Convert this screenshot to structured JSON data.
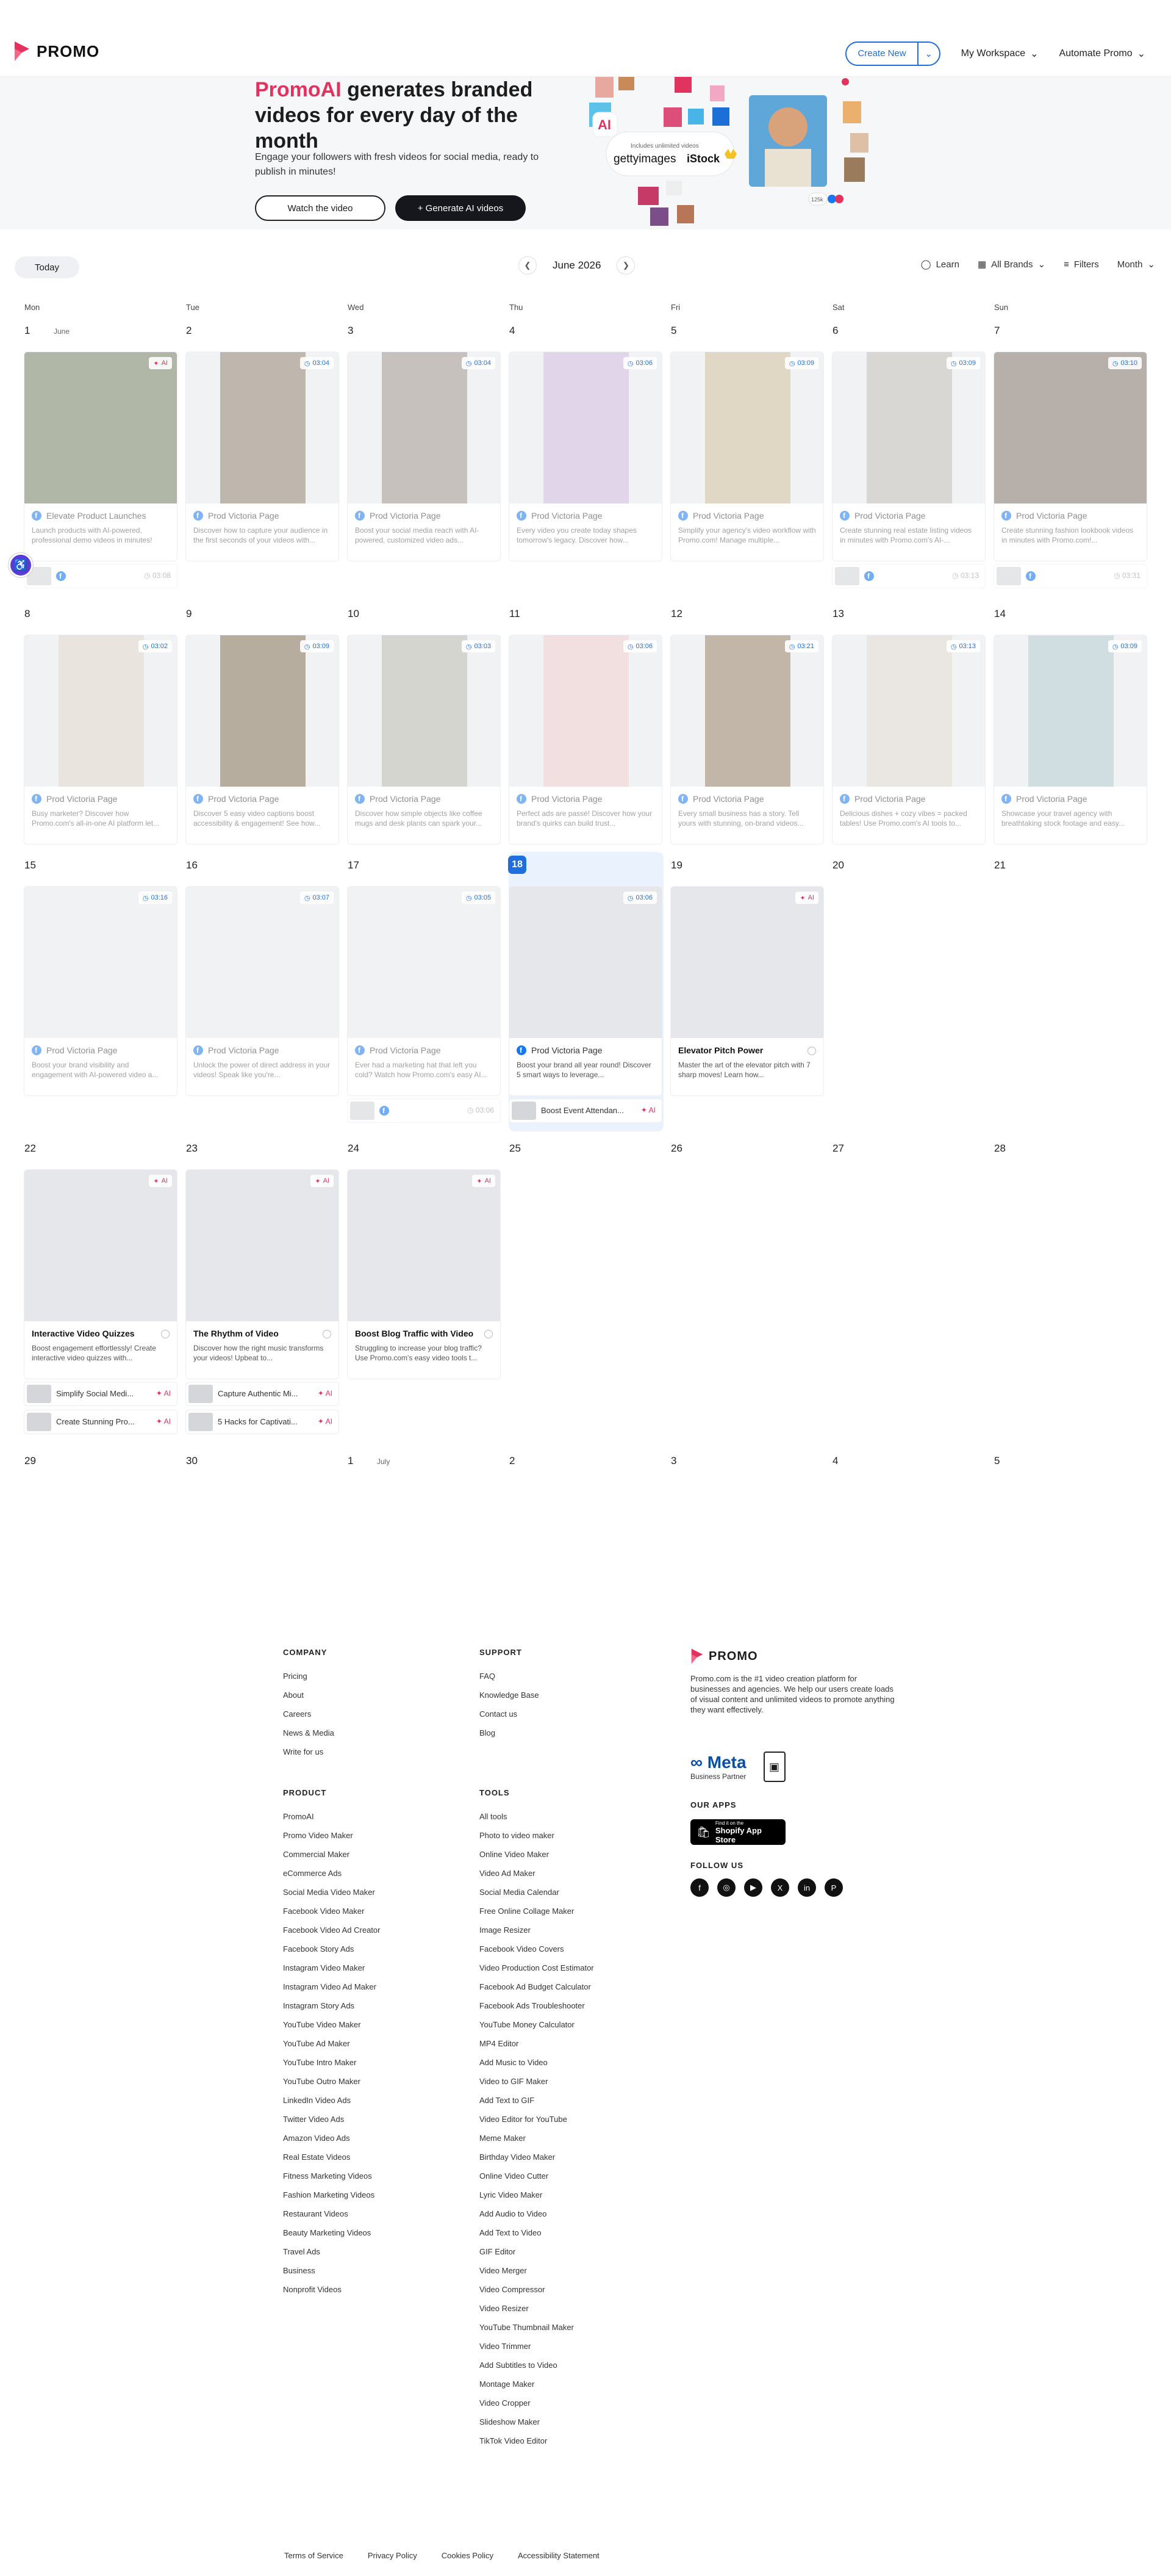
{
  "header": {
    "logo": "PROMO",
    "create_new": "Create New",
    "my_workspace": "My Workspace",
    "automate_promo": "Automate Promo"
  },
  "hero": {
    "title_brand": "PromoAI",
    "title_rest": " generates branded videos for every day of the month",
    "subtitle": "Engage your followers with fresh videos for social media, ready to publish in minutes!",
    "btn_watch": "Watch the video",
    "btn_generate": "+ Generate AI videos",
    "collage_text1": "Includes unlimited videos",
    "collage_getty": "gettyimages",
    "collage_istock": "iStock",
    "collage_ai": "AI",
    "collage_count": "125k"
  },
  "toolbar": {
    "today": "Today",
    "month_title": "June 2026",
    "learn": "Learn",
    "all_brands": "All Brands",
    "filters": "Filters",
    "view": "Month"
  },
  "weekdays": [
    "Mon",
    "Tue",
    "Wed",
    "Thu",
    "Fri",
    "Sat",
    "Sun"
  ],
  "labels": {
    "june": "June",
    "july": "July",
    "ai": "AI",
    "page": "Prod Victoria Page"
  },
  "weeks": [
    [
      "1",
      "2",
      "3",
      "4",
      "5",
      "6",
      "7"
    ],
    [
      "8",
      "9",
      "10",
      "11",
      "12",
      "13",
      "14"
    ],
    [
      "15",
      "16",
      "17",
      "18",
      "19",
      "20",
      "21"
    ],
    [
      "22",
      "23",
      "24",
      "25",
      "26",
      "27",
      "28"
    ],
    [
      "29",
      "30",
      "1",
      "2",
      "3",
      "4",
      "5"
    ]
  ],
  "cards": [
    {
      "title": "Elevate Product Launches",
      "desc": "Launch products with AI-powered, professional demo videos in minutes!",
      "tag": "AI",
      "faded": true,
      "sub": {
        "type": "fb",
        "time": "03:08"
      }
    },
    {
      "title": "Prod Victoria Page",
      "desc": "Discover how to capture your audience in the first seconds of your videos with...",
      "tag": "03:04",
      "faded": true
    },
    {
      "title": "Prod Victoria Page",
      "desc": "Boost your social media reach with AI-powered, customized video ads...",
      "tag": "03:04",
      "faded": true
    },
    {
      "title": "Prod Victoria Page",
      "desc": "Every video you create today shapes tomorrow's legacy. Discover how...",
      "tag": "03:06",
      "faded": true
    },
    {
      "title": "Prod Victoria Page",
      "desc": "Simplify your agency's video workflow with Promo.com! Manage multiple...",
      "tag": "03:09",
      "faded": true
    },
    {
      "title": "Prod Victoria Page",
      "desc": "Create stunning real estate listing videos in minutes with Promo.com's AI-...",
      "tag": "03:09",
      "faded": true,
      "sub": {
        "type": "fb",
        "time": "03:13"
      }
    },
    {
      "title": "Prod Victoria Page",
      "desc": "Create stunning fashion lookbook videos in minutes with Promo.com!...",
      "tag": "03:10",
      "faded": true,
      "sub": {
        "type": "fb",
        "time": "03:31"
      }
    },
    {
      "title": "Prod Victoria Page",
      "desc": "Busy marketer? Discover how Promo.com's all-in-one AI platform let...",
      "tag": "03:02",
      "faded": true
    },
    {
      "title": "Prod Victoria Page",
      "desc": "Discover 5 easy video captions boost accessibility & engagement! See how...",
      "tag": "03:09",
      "faded": true
    },
    {
      "title": "Prod Victoria Page",
      "desc": "Discover how simple objects like coffee mugs and desk plants can spark your...",
      "tag": "03:03",
      "faded": true
    },
    {
      "title": "Prod Victoria Page",
      "desc": "Perfect ads are passé! Discover how your brand's quirks can build trust...",
      "tag": "03:06",
      "faded": true
    },
    {
      "title": "Prod Victoria Page",
      "desc": "Every small business has a story. Tell yours with stunning, on-brand videos...",
      "tag": "03:21",
      "faded": true
    },
    {
      "title": "Prod Victoria Page",
      "desc": "Delicious dishes + cozy vibes = packed tables! Use Promo.com's AI tools to...",
      "tag": "03:13",
      "faded": true
    },
    {
      "title": "Prod Victoria Page",
      "desc": "Showcase your travel agency with breathtaking stock footage and easy...",
      "tag": "03:09",
      "faded": true
    },
    {
      "title": "Prod Victoria Page",
      "desc": "Boost your brand visibility and engagement with AI-powered video a...",
      "tag": "03:16",
      "faded": true
    },
    {
      "title": "Prod Victoria Page",
      "desc": "Unlock the power of direct address in your videos! Speak like you're...",
      "tag": "03:07",
      "faded": true
    },
    {
      "title": "Prod Victoria Page",
      "desc": "Ever had a marketing hat that left you cold? Watch how Promo.com's easy AI...",
      "tag": "03:05",
      "faded": true,
      "sub": {
        "type": "fb",
        "time": "03:06"
      }
    },
    {
      "title": "Prod Victoria Page",
      "desc": "Boost your brand all year round! Discover 5 smart ways to leverage...",
      "tag": "03:06",
      "faded": false,
      "timetag": true,
      "sub": {
        "type": "text",
        "text": "Boost Event Attendan...",
        "ai": "AI"
      }
    },
    {
      "title": "Elevator Pitch Power",
      "desc": "Master the art of the elevator pitch with 7 sharp moves! Learn how...",
      "tag": "AI",
      "faded": false,
      "bold": true
    },
    {
      "title": "Interactive Video Quizzes",
      "desc": "Boost engagement effortlessly! Create interactive video quizzes with...",
      "tag": "AI",
      "faded": false,
      "bold": true,
      "subs": [
        {
          "text": "Simplify Social Medi...",
          "ai": "AI"
        },
        {
          "text": "Create Stunning Pro...",
          "ai": "AI"
        }
      ]
    },
    {
      "title": "The Rhythm of Video",
      "desc": "Discover how the right music transforms your videos! Upbeat to...",
      "tag": "AI",
      "faded": false,
      "bold": true,
      "subs": [
        {
          "text": "Capture Authentic Mi...",
          "ai": "AI"
        },
        {
          "text": "5 Hacks for Captivati...",
          "ai": "AI"
        }
      ]
    },
    {
      "title": "Boost Blog Traffic with Video",
      "desc": "Struggling to increase your blog traffic? Use Promo.com's easy video tools t...",
      "tag": "AI",
      "faded": false,
      "bold": true
    }
  ],
  "footer": {
    "company_title": "COMPANY",
    "company": [
      "Pricing",
      "About",
      "Careers",
      "News & Media",
      "Write for us"
    ],
    "support_title": "SUPPORT",
    "support": [
      "FAQ",
      "Knowledge Base",
      "Contact us",
      "Blog"
    ],
    "product_title": "PRODUCT",
    "product": [
      "PromoAI",
      "Promo Video Maker",
      "Commercial Maker",
      "eCommerce Ads",
      "Social Media Video Maker",
      "Facebook Video Maker",
      "Facebook Video Ad Creator",
      "Facebook Story Ads",
      "Instagram Video Maker",
      "Instagram Video Ad Maker",
      "Instagram Story Ads",
      "YouTube Video Maker",
      "YouTube Ad Maker",
      "YouTube Intro Maker",
      "YouTube Outro Maker",
      "LinkedIn Video Ads",
      "Twitter Video Ads",
      "Amazon Video Ads",
      "Real Estate Videos",
      "Fitness Marketing Videos",
      "Fashion Marketing Videos",
      "Restaurant Videos",
      "Beauty Marketing Videos",
      "Travel Ads",
      "Business",
      "Nonprofit Videos"
    ],
    "tools_title": "TOOLS",
    "tools": [
      "All tools",
      "Photo to video maker",
      "Online Video Maker",
      "Video Ad Maker",
      "Social Media Calendar",
      "Free Online Collage Maker",
      "Image Resizer",
      "Facebook Video Covers",
      "Video Production Cost Estimator",
      "Facebook Ad Budget Calculator",
      "Facebook Ads Troubleshooter",
      "YouTube Money Calculator",
      "MP4 Editor",
      "Add Music to Video",
      "Video to GIF Maker",
      "Add Text to GIF",
      "Video Editor for YouTube",
      "Meme Maker",
      "Birthday Video Maker",
      "Online Video Cutter",
      "Lyric Video Maker",
      "Add Audio to Video",
      "Add Text to Video",
      "GIF Editor",
      "Video Merger",
      "Video Compressor",
      "Video Resizer",
      "YouTube Thumbnail Maker",
      "Video Trimmer",
      "Add Subtitles to Video",
      "Montage Maker",
      "Video Cropper",
      "Slideshow Maker",
      "TikTok Video Editor"
    ],
    "about_logo": "PROMO",
    "about": "Promo.com is the #1 video creation platform for businesses and agencies. We help our users create loads of visual content and unlimited videos to promote anything they want effectively.",
    "meta": "Meta",
    "meta_sub": "Business Partner",
    "apps_title": "OUR APPS",
    "app_store_small": "Find it on the",
    "app_store": "Shopify App Store",
    "follow_title": "FOLLOW US",
    "social_icons": [
      "facebook-icon",
      "instagram-icon",
      "youtube-icon",
      "x-icon",
      "linkedin-icon",
      "pinterest-icon"
    ],
    "social_glyphs": [
      "f",
      "◎",
      "▶",
      "X",
      "in",
      "P"
    ],
    "legal": [
      "Terms of Service",
      "Privacy Policy",
      "Cookies Policy",
      "Accessibility Statement"
    ]
  }
}
